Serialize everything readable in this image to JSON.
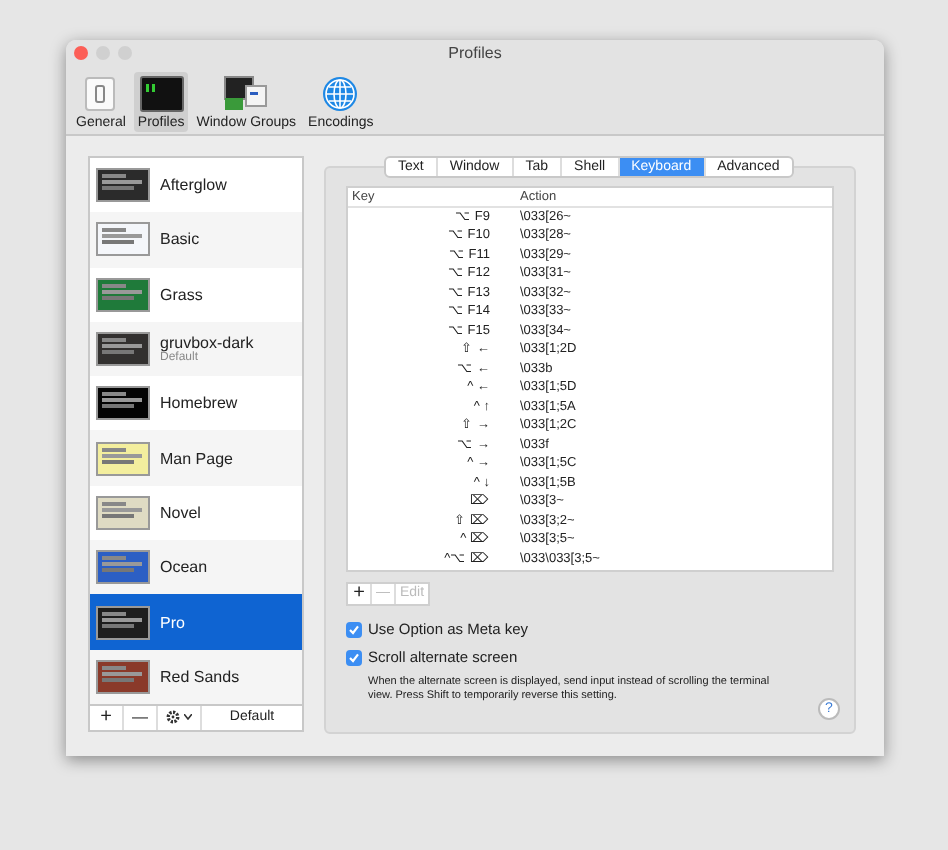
{
  "window": {
    "title": "Profiles"
  },
  "toolbar": [
    {
      "label": "General",
      "kind": "general",
      "selected": false
    },
    {
      "label": "Profiles",
      "kind": "profiles",
      "selected": true
    },
    {
      "label": "Window Groups",
      "kind": "groups",
      "selected": false
    },
    {
      "label": "Encodings",
      "kind": "encodings",
      "selected": false
    }
  ],
  "profiles": [
    {
      "name": "Afterglow",
      "color": "#2b2b2b",
      "selected": false
    },
    {
      "name": "Basic",
      "color": "#f4f6fa",
      "selected": false
    },
    {
      "name": "Grass",
      "color": "#1f7a3a",
      "selected": false
    },
    {
      "name": "gruvbox-dark",
      "subtitle": "Default",
      "color": "#32302f",
      "selected": false
    },
    {
      "name": "Homebrew",
      "color": "#050505",
      "selected": false
    },
    {
      "name": "Man Page",
      "color": "#f3ee9e",
      "selected": false
    },
    {
      "name": "Novel",
      "color": "#dfdbc3",
      "selected": false
    },
    {
      "name": "Ocean",
      "color": "#2c5fc4",
      "selected": false
    },
    {
      "name": "Pro",
      "color": "#1e1e1e",
      "selected": true
    },
    {
      "name": "Red Sands",
      "color": "#8a3a2a",
      "selected": false
    }
  ],
  "profile_buttons": {
    "add": "+",
    "remove": "—",
    "default": "Default"
  },
  "tabs": [
    {
      "label": "Text",
      "selected": false
    },
    {
      "label": "Window",
      "selected": false
    },
    {
      "label": "Tab",
      "selected": false
    },
    {
      "label": "Shell",
      "selected": false
    },
    {
      "label": "Keyboard",
      "selected": true
    },
    {
      "label": "Advanced",
      "selected": false
    }
  ],
  "table": {
    "columns": [
      "Key",
      "Action"
    ],
    "rows": [
      [
        "⌥ F9",
        "\\033[26~"
      ],
      [
        "⌥ F10",
        "\\033[28~"
      ],
      [
        "⌥ F11",
        "\\033[29~"
      ],
      [
        "⌥ F12",
        "\\033[31~"
      ],
      [
        "⌥ F13",
        "\\033[32~"
      ],
      [
        "⌥ F14",
        "\\033[33~"
      ],
      [
        "⌥ F15",
        "\\033[34~"
      ],
      [
        "⇧ ←",
        "\\033[1;2D"
      ],
      [
        "⌥ ←",
        "\\033b"
      ],
      [
        "^ ←",
        "\\033[1;5D"
      ],
      [
        "^ ↑",
        "\\033[1;5A"
      ],
      [
        "⇧ →",
        "\\033[1;2C"
      ],
      [
        "⌥ →",
        "\\033f"
      ],
      [
        "^ →",
        "\\033[1;5C"
      ],
      [
        "^ ↓",
        "\\033[1;5B"
      ],
      [
        "⌦",
        "\\033[3~"
      ],
      [
        "⇧ ⌦",
        "\\033[3;2~"
      ],
      [
        "^ ⌦",
        "\\033[3;5~"
      ],
      [
        "^⌥ ⌦",
        "\\033\\033[3;5~"
      ]
    ]
  },
  "table_buttons": {
    "add": "+",
    "remove": "—",
    "edit": "Edit"
  },
  "options": [
    {
      "label": "Use Option as Meta key",
      "checked": true
    },
    {
      "label": "Scroll alternate screen",
      "checked": true
    }
  ],
  "note": "When the alternate screen is displayed, send input instead of scrolling the terminal view. Press Shift to temporarily reverse this setting.",
  "help": "?"
}
